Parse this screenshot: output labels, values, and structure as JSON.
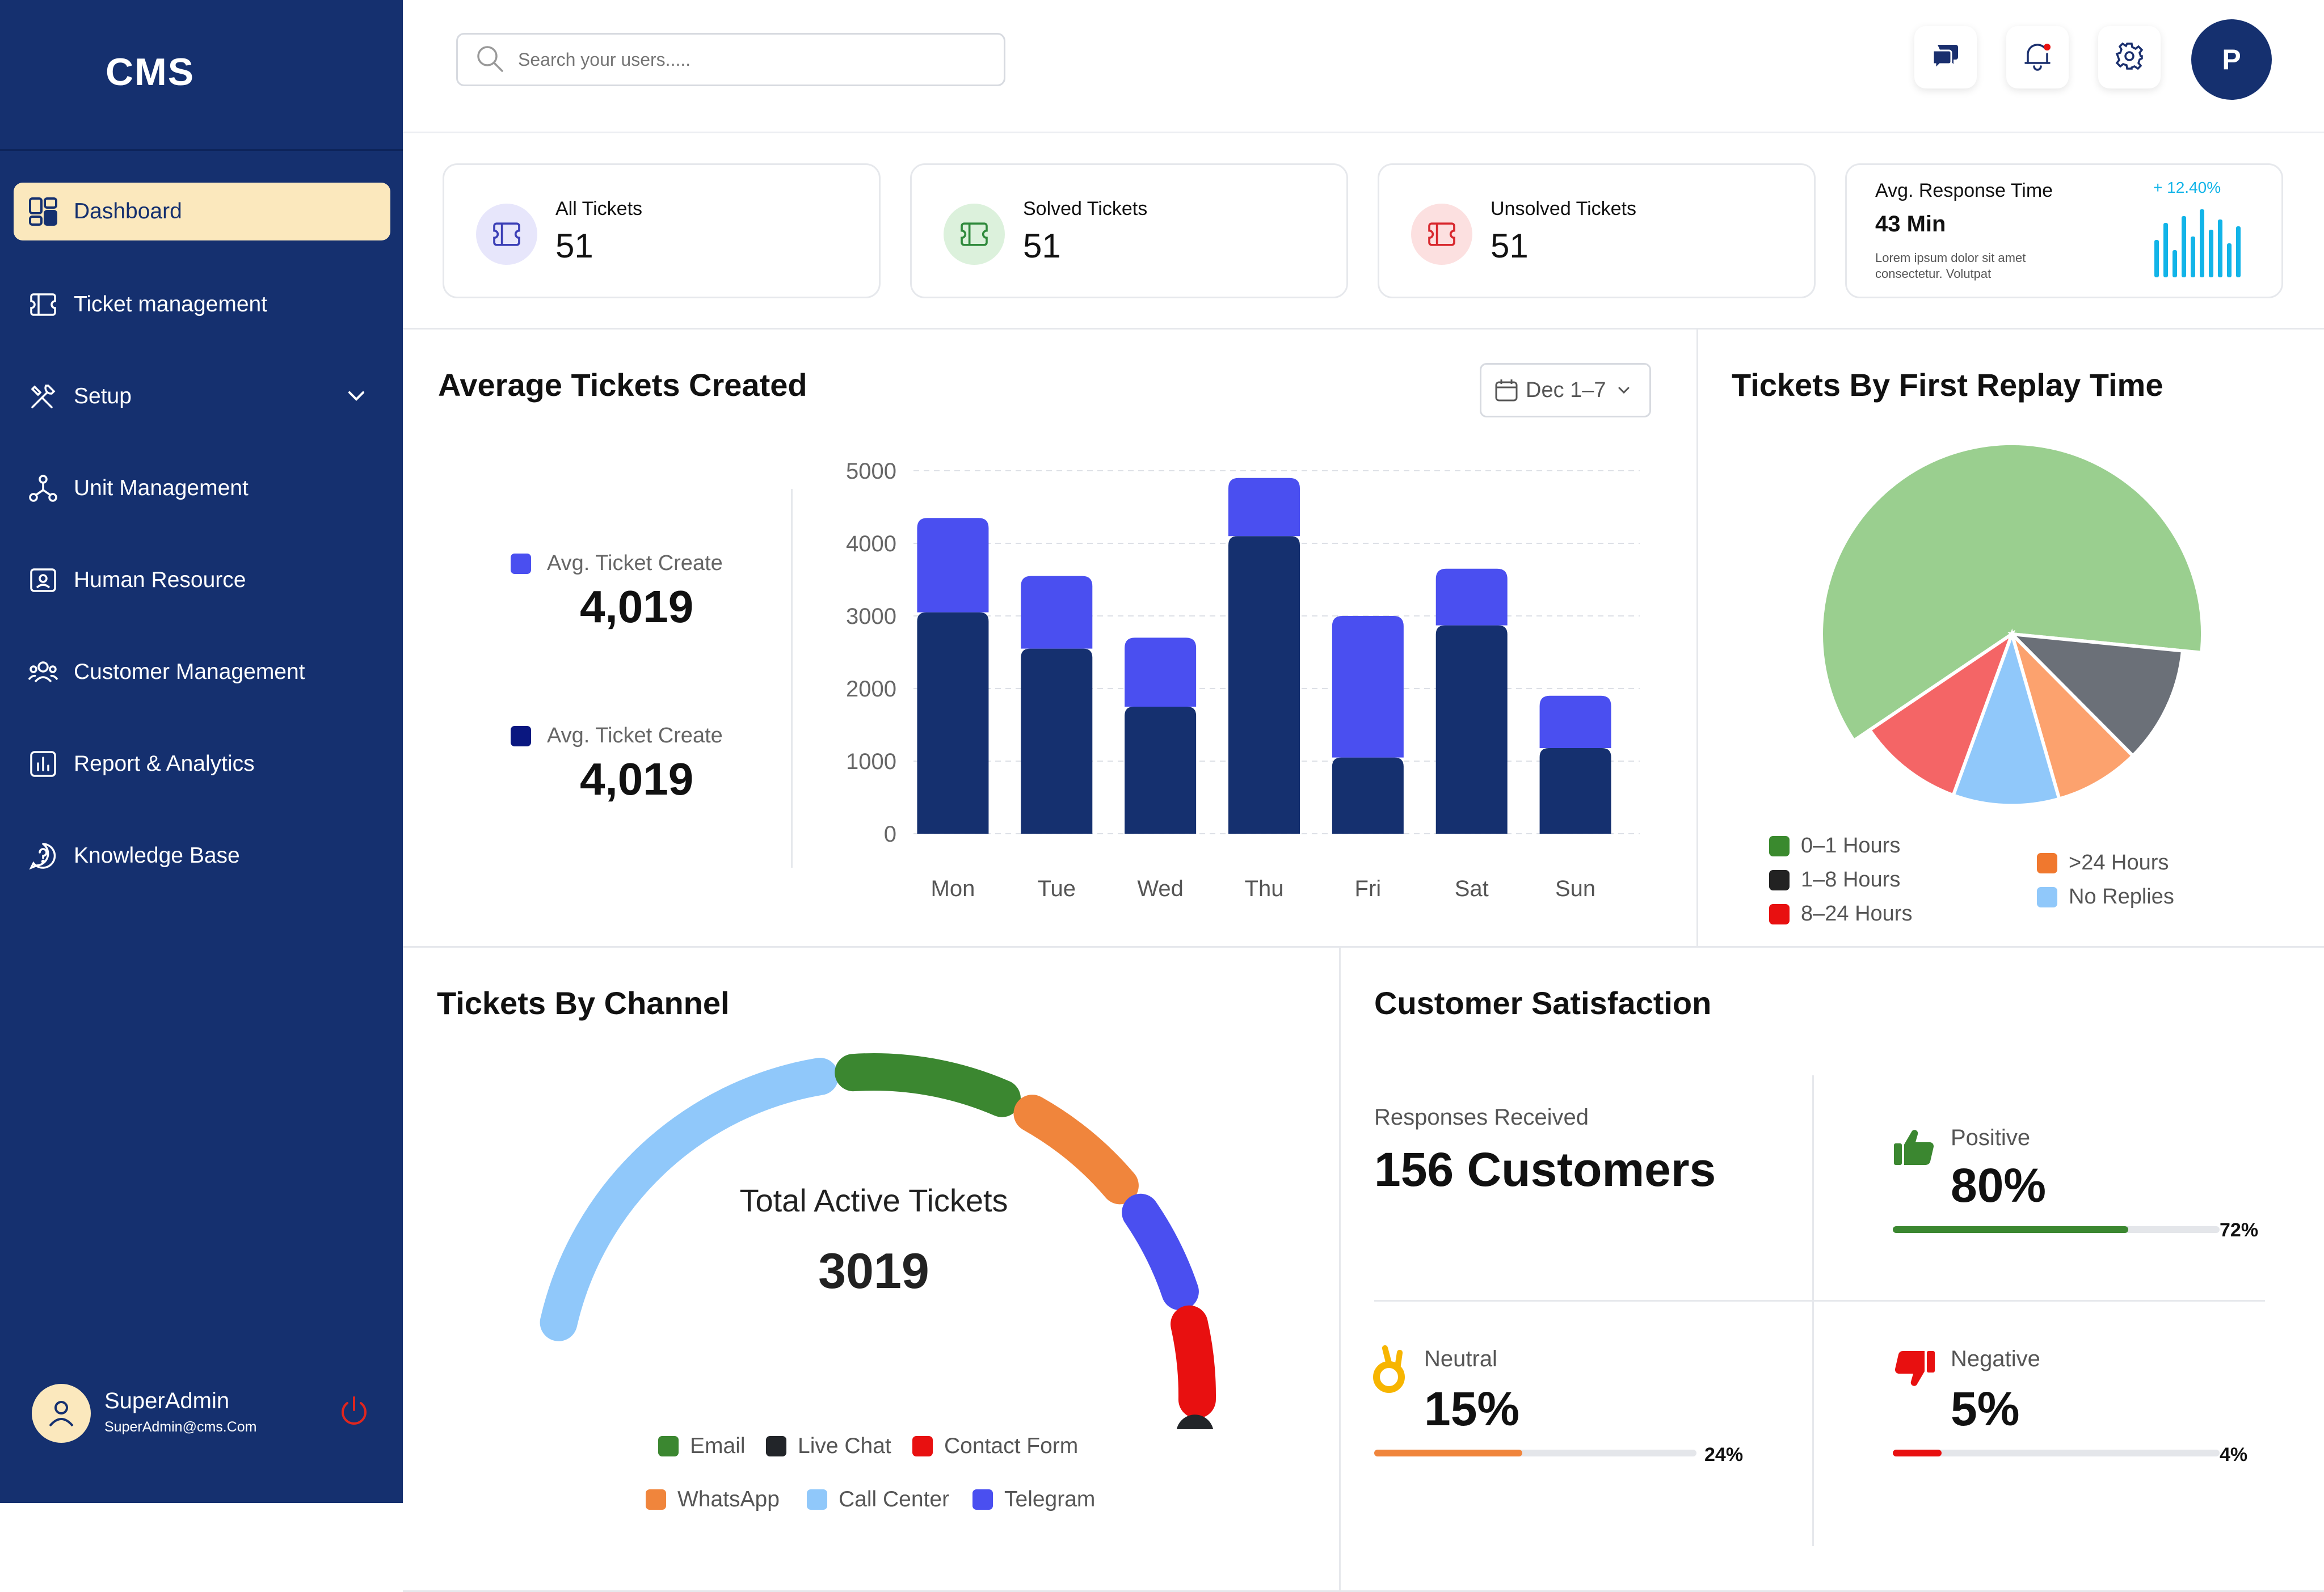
{
  "app": {
    "logo": "CMS"
  },
  "sidebar": {
    "items": [
      {
        "label": "Dashboard"
      },
      {
        "label": "Ticket management"
      },
      {
        "label": "Setup"
      },
      {
        "label": "Unit Management"
      },
      {
        "label": "Human Resource"
      },
      {
        "label": "Customer Management"
      },
      {
        "label": "Report & Analytics"
      },
      {
        "label": "Knowledge Base"
      }
    ],
    "user": {
      "name": "SuperAdmin",
      "email": "SuperAdmin@cms.Com"
    }
  },
  "header": {
    "search_placeholder": "Search your users.....",
    "avatar_initial": "P"
  },
  "colors": {
    "primary": "#15306f",
    "active_bg": "#fbe8bd",
    "accent_cyan": "#12b4e8"
  },
  "stats": [
    {
      "label": "All Tickets",
      "value": "51",
      "icon": "ticket-icon"
    },
    {
      "label": "Solved Tickets",
      "value": "51",
      "icon": "ticket-icon"
    },
    {
      "label": "Unsolved Tickets",
      "value": "51",
      "icon": "ticket-icon"
    }
  ],
  "response": {
    "label": "Avg. Response Time",
    "value": "43 Min",
    "desc": "Lorem ipsum dolor sit amet consectetur. Volutpat",
    "change": "+ 12.40%",
    "spark": [
      55,
      80,
      40,
      90,
      60,
      100,
      70,
      85,
      50,
      75
    ]
  },
  "avg_tickets": {
    "title": "Average Tickets Created",
    "date_range": "Dec 1–7",
    "legend": [
      {
        "label": "Avg. Ticket Create",
        "value": "4,019",
        "color": "#4a4ff0"
      },
      {
        "label": "Avg. Ticket Create",
        "value": "4,019",
        "color": "#0a1780"
      }
    ]
  },
  "chart_data": [
    {
      "type": "bar",
      "stacked": true,
      "categories": [
        "Mon",
        "Tue",
        "Wed",
        "Thu",
        "Fri",
        "Sat",
        "Sun"
      ],
      "series": [
        {
          "values": [
            3050,
            2550,
            1750,
            4100,
            1050,
            2870,
            1180
          ],
          "color": "#15306f"
        },
        {
          "values": [
            1300,
            1000,
            950,
            800,
            1950,
            780,
            720
          ],
          "color": "#4a4ff0"
        }
      ],
      "y_ticks": [
        0,
        1000,
        2000,
        3000,
        4000,
        5000
      ],
      "ylim": [
        0,
        5000
      ],
      "grid": true
    },
    {
      "type": "pie",
      "title": "Tickets By First Replay Time",
      "slices": [
        {
          "label": "0–1 Hours",
          "value": 61,
          "color": "#9acf8f",
          "legend_color": "#3a8a2e"
        },
        {
          "label": "1–8 Hours",
          "value": 11,
          "color": "#6b7078",
          "legend_color": "#222222"
        },
        {
          "label": ">24 Hours",
          "value": 8,
          "color": "#fca26e",
          "legend_color": "#f0782e"
        },
        {
          "label": "No Replies",
          "value": 10,
          "color": "#90c8fa",
          "legend_color": "#90c8fa"
        },
        {
          "label": "8–24 Hours",
          "value": 10,
          "color": "#f46566",
          "legend_color": "#e81010"
        }
      ]
    },
    {
      "type": "gauge",
      "title": "Tickets By Channel",
      "center_label": "Total Active Tickets",
      "total": "3019",
      "segments": [
        {
          "label": "Call Center",
          "value": 30,
          "color": "#90c8fa"
        },
        {
          "label": "Email",
          "value": 12,
          "color": "#3b8730"
        },
        {
          "label": "WhatsApp",
          "value": 9,
          "color": "#f0853c"
        },
        {
          "label": "Telegram",
          "value": 7,
          "color": "#4a4ff0"
        },
        {
          "label": "Contact Form",
          "value": 6,
          "color": "#e81010"
        },
        {
          "label": "Live Chat",
          "value": 9,
          "color": "#222529"
        }
      ]
    }
  ],
  "replay": {
    "legend": [
      {
        "label": "0–1 Hours",
        "color": "#3a8a2e"
      },
      {
        "label": "1–8 Hours",
        "color": "#222222"
      },
      {
        "label": "8–24 Hours",
        "color": "#e81010"
      },
      {
        "label": ">24 Hours",
        "color": "#f0782e"
      },
      {
        "label": "No Replies",
        "color": "#90c8fa"
      }
    ]
  },
  "channel": {
    "legend": [
      {
        "label": "Email",
        "color": "#3b8730"
      },
      {
        "label": "Live Chat",
        "color": "#222529"
      },
      {
        "label": "Contact Form",
        "color": "#e81010"
      },
      {
        "label": "WhatsApp",
        "color": "#f0853c"
      },
      {
        "label": "Call Center",
        "color": "#90c8fa"
      },
      {
        "label": "Telegram",
        "color": "#4a4ff0"
      }
    ]
  },
  "satisfaction": {
    "title": "Customer Satisfaction",
    "responses_label": "Responses Received",
    "responses_value": "156 Customers",
    "items": [
      {
        "label": "Positive",
        "value": "80%",
        "bar_pct": 0.72,
        "bar_label": "72%",
        "color": "#3b8730",
        "icon": "thumbs-up-icon"
      },
      {
        "label": "Neutral",
        "value": "15%",
        "bar_pct": 0.46,
        "bar_label": "24%",
        "color": "#f0853c",
        "icon": "ok-hand-icon"
      },
      {
        "label": "Negative",
        "value": "5%",
        "bar_pct": 0.15,
        "bar_label": "4%",
        "color": "#e81010",
        "icon": "thumbs-down-icon"
      }
    ]
  }
}
